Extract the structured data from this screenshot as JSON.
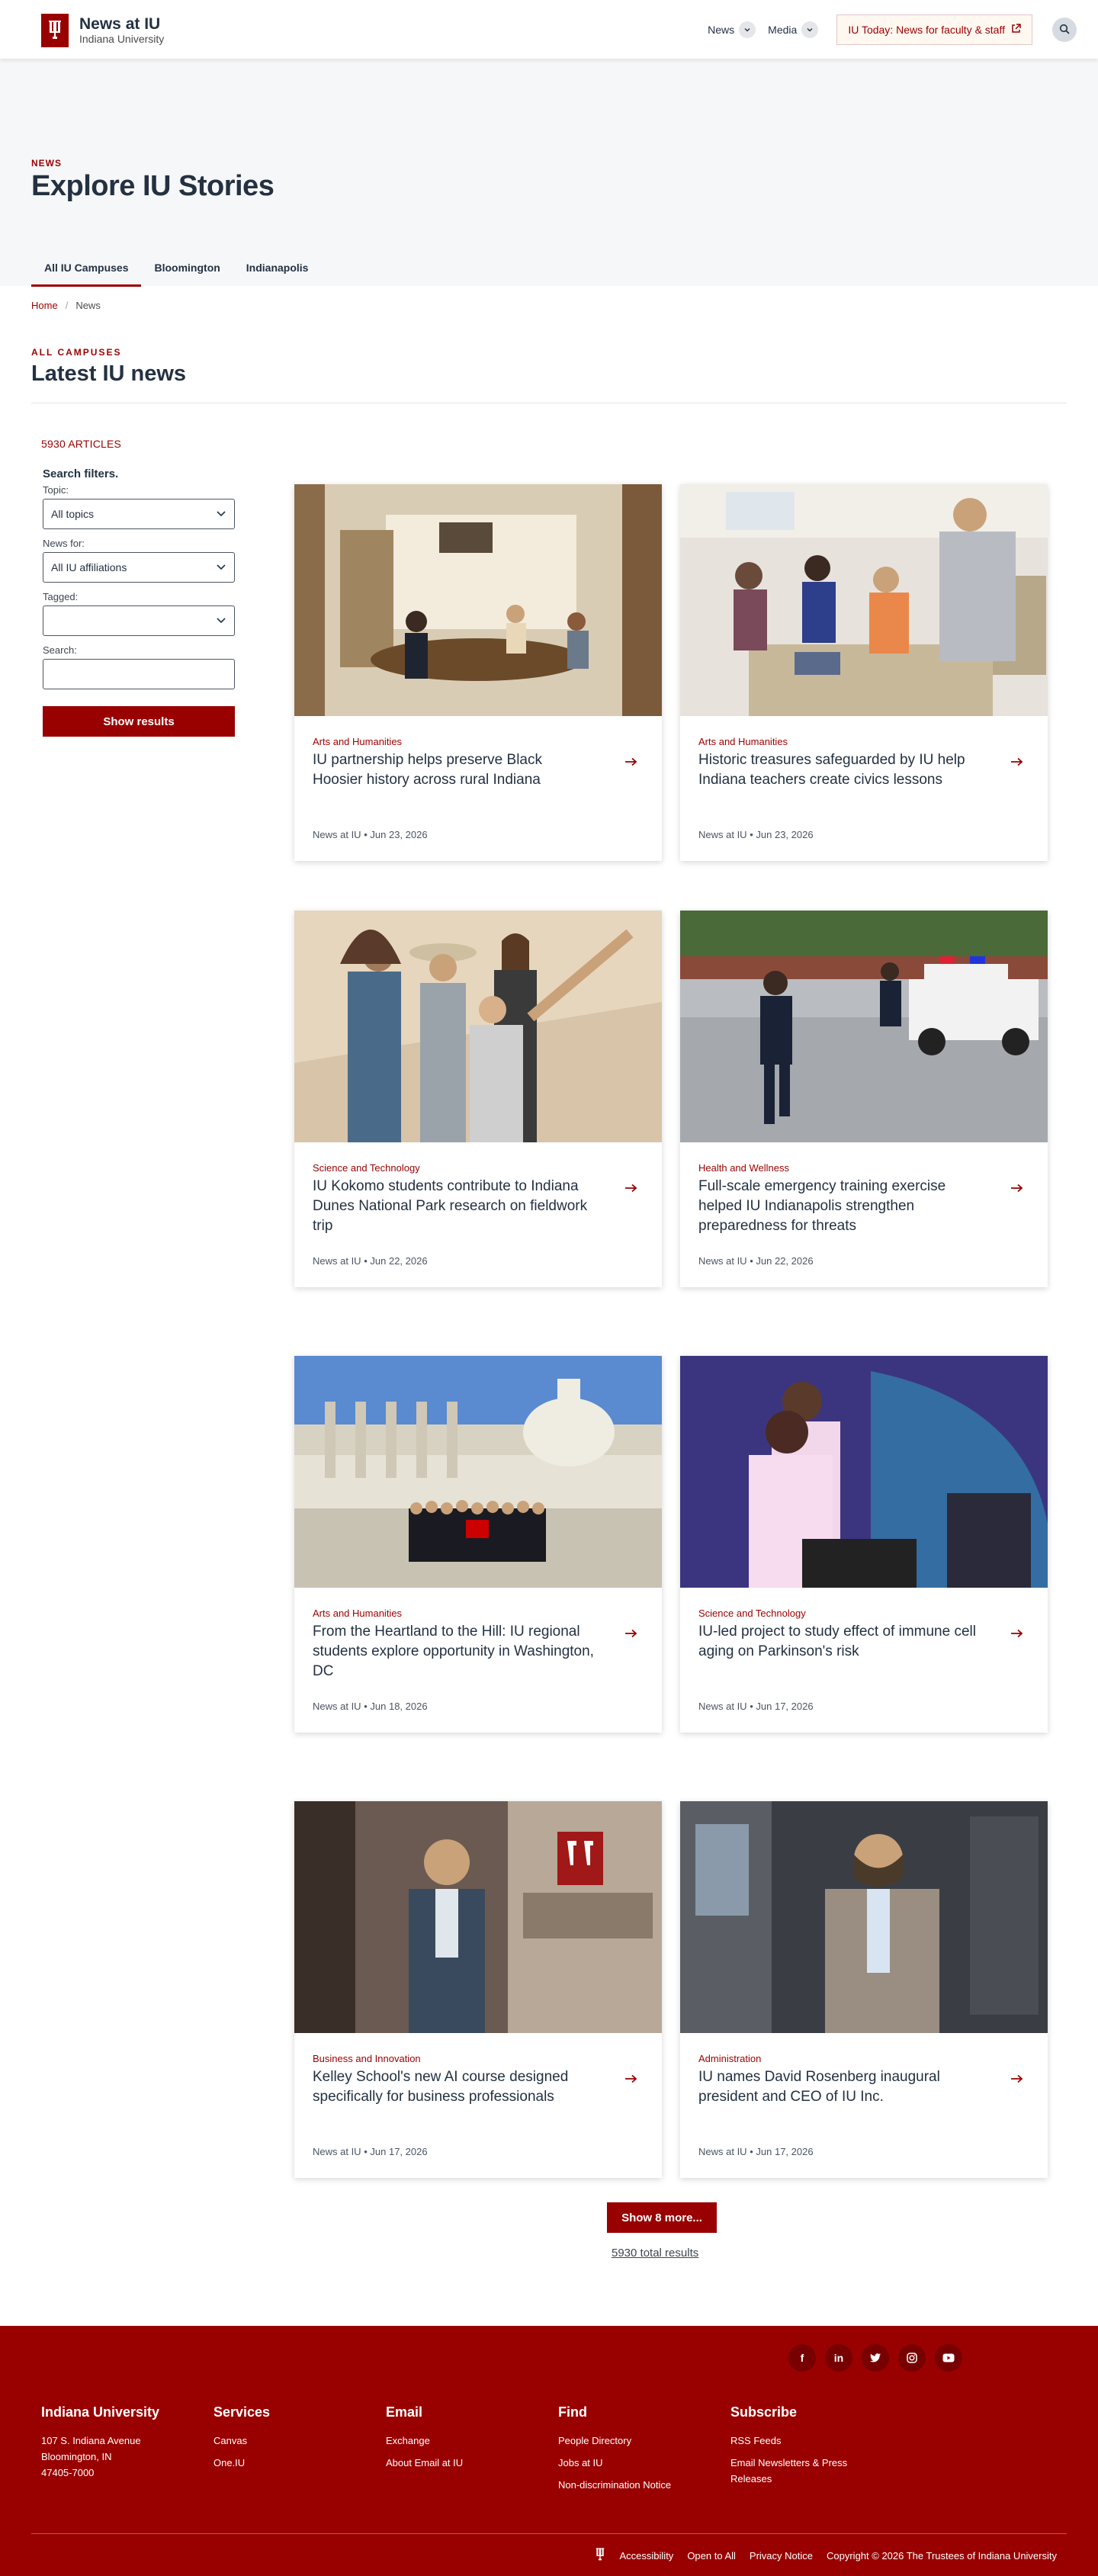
{
  "header": {
    "site_title": "News at IU",
    "site_subtitle": "Indiana University",
    "nav": [
      {
        "label": "News"
      },
      {
        "label": "Media"
      }
    ],
    "iu_today_label": "IU Today: News for faculty & staff"
  },
  "hero": {
    "eyebrow": "NEWS",
    "title": "Explore IU Stories",
    "tabs": [
      {
        "label": "All IU Campuses",
        "active": true
      },
      {
        "label": "Bloomington",
        "active": false
      },
      {
        "label": "Indianapolis",
        "active": false
      }
    ]
  },
  "breadcrumb": {
    "home": "Home",
    "separator": "/",
    "current": "News"
  },
  "latest": {
    "eyebrow": "ALL CAMPUSES",
    "title": "Latest IU news"
  },
  "filters": {
    "count": "5930 ARTICLES",
    "title": "Search filters.",
    "topic_label": "Topic:",
    "topic_value": "All topics",
    "news_for_label": "News for:",
    "news_for_value": "All IU affiliations",
    "tagged_label": "Tagged:",
    "tagged_value": "",
    "search_label": "Search:",
    "search_value": "",
    "submit_label": "Show results"
  },
  "articles": [
    {
      "category": "Arts and Humanities",
      "title": "IU partnership helps preserve Black Hoosier history across rural Indiana",
      "source": "News at IU",
      "date": "Jun 23, 2026"
    },
    {
      "category": "Arts and Humanities",
      "title": "Historic treasures safeguarded by IU help Indiana teachers create civics lessons",
      "source": "News at IU",
      "date": "Jun 23, 2026"
    },
    {
      "category": "Science and Technology",
      "title": "IU Kokomo students contribute to Indiana Dunes National Park research on fieldwork trip",
      "source": "News at IU",
      "date": "Jun 22, 2026"
    },
    {
      "category": "Health and Wellness",
      "title": "Full-scale emergency training exercise helped IU Indianapolis strengthen preparedness for threats",
      "source": "News at IU",
      "date": "Jun 22, 2026"
    },
    {
      "category": "Arts and Humanities",
      "title": "From the Heartland to the Hill: IU regional students explore opportunity in Washington, DC",
      "source": "News at IU",
      "date": "Jun 18, 2026"
    },
    {
      "category": "Science and Technology",
      "title": "IU-led project to study effect of immune cell aging on Parkinson's risk",
      "source": "News at IU",
      "date": "Jun 17, 2026"
    },
    {
      "category": "Business and Innovation",
      "title": "Kelley School's new AI course designed specifically for business professionals",
      "source": "News at IU",
      "date": "Jun 17, 2026"
    },
    {
      "category": "Administration",
      "title": "IU names David Rosenberg inaugural president and CEO of IU Inc.",
      "source": "News at IU",
      "date": "Jun 17, 2026"
    }
  ],
  "meta_separator": "•",
  "pagination": {
    "more_label": "Show 8 more...",
    "total_label": "5930 total results"
  },
  "footer": {
    "social": [
      "facebook-icon",
      "linkedin-icon",
      "twitter-icon",
      "instagram-icon",
      "youtube-icon"
    ],
    "columns": [
      {
        "heading": "Indiana University",
        "lines": [
          "107 S. Indiana Avenue",
          "Bloomington, IN",
          "47405-7000"
        ]
      },
      {
        "heading": "Services",
        "links": [
          "Canvas",
          "One.IU"
        ]
      },
      {
        "heading": "Email",
        "links": [
          "Exchange",
          "About Email at IU"
        ]
      },
      {
        "heading": "Find",
        "links": [
          "People Directory",
          "Jobs at IU",
          "Non-discrimination Notice"
        ]
      },
      {
        "heading": "Subscribe",
        "links": [
          "RSS Feeds",
          "Email Newsletters & Press Releases"
        ]
      }
    ],
    "bottom_links": [
      "Accessibility",
      "Open to All",
      "Privacy Notice"
    ],
    "copyright": "Copyright © 2026 The Trustees of Indiana University"
  },
  "colors": {
    "brand": "#990000",
    "text": "#243142",
    "hero_bg": "#f6f7f9"
  }
}
